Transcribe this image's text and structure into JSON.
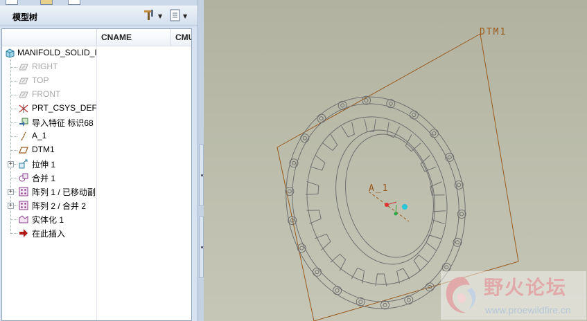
{
  "panel": {
    "title": "模型树",
    "columns": {
      "tree": "",
      "cname": "CNAME",
      "cmu": "CMU"
    }
  },
  "tree": {
    "root": "MANIFOLD_SOLID_I",
    "items": [
      {
        "label": "RIGHT",
        "icon": "datum-plane-icon",
        "dim": true
      },
      {
        "label": "TOP",
        "icon": "datum-plane-icon",
        "dim": true
      },
      {
        "label": "FRONT",
        "icon": "datum-plane-icon",
        "dim": true
      },
      {
        "label": "PRT_CSYS_DEF",
        "icon": "coordinate-system-icon",
        "dim": false
      },
      {
        "label": "导入特征 标识68",
        "icon": "import-feature-icon",
        "dim": false
      },
      {
        "label": "A_1",
        "icon": "datum-axis-icon",
        "dim": false
      },
      {
        "label": "DTM1",
        "icon": "datum-plane-icon",
        "dim": false
      },
      {
        "label": "拉伸 1",
        "icon": "extrude-icon",
        "dim": false,
        "expandable": true
      },
      {
        "label": "合并 1",
        "icon": "merge-icon",
        "dim": false
      },
      {
        "label": "阵列 1 / 已移动副",
        "icon": "pattern-icon",
        "dim": false,
        "expandable": true
      },
      {
        "label": "阵列 2 / 合并 2",
        "icon": "pattern-icon",
        "dim": false,
        "expandable": true
      },
      {
        "label": "实体化 1",
        "icon": "solidify-icon",
        "dim": false
      },
      {
        "label": "在此插入",
        "icon": "insert-here-arrow-icon",
        "dim": false
      }
    ]
  },
  "viewport": {
    "plane_label": "DTM1",
    "axis_label": "A_1"
  },
  "watermark": {
    "title": "野火论坛",
    "url": "www.proewildfire.cn"
  },
  "colors": {
    "datum": "#9a5a1e",
    "model_lines": "#6f7070",
    "background": "#b9b9a8"
  }
}
